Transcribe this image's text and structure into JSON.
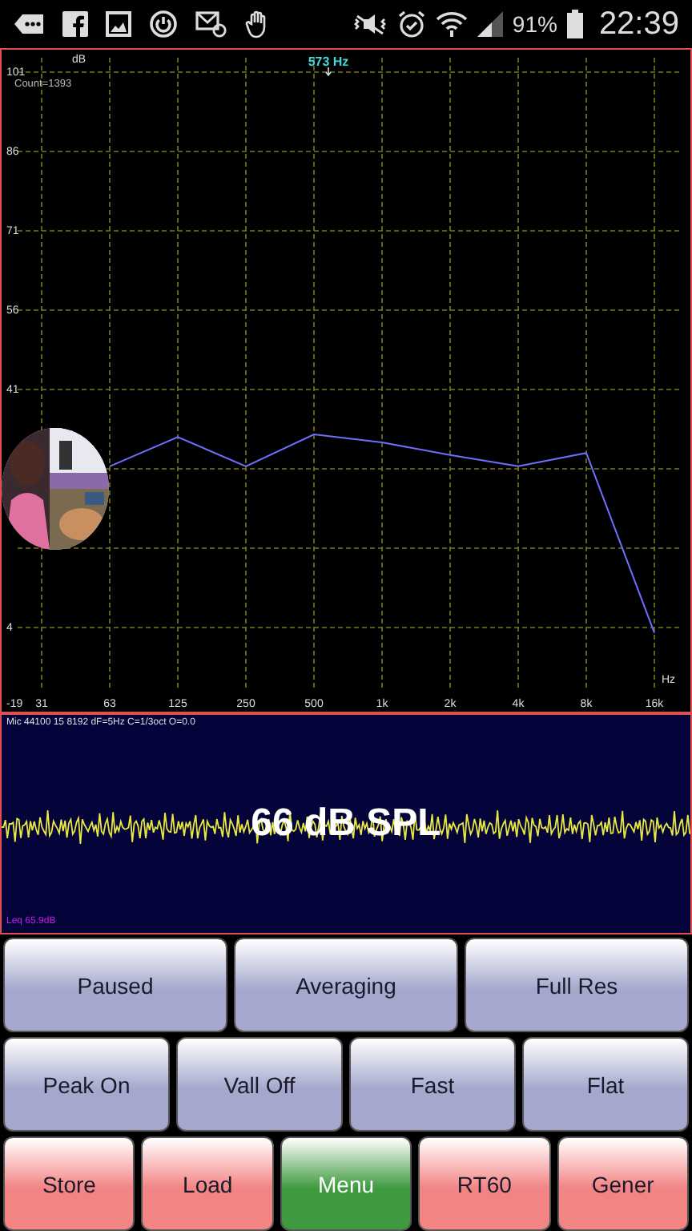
{
  "status_bar": {
    "battery": "91%",
    "time": "22:39"
  },
  "spectrum": {
    "count": "Count=1393",
    "peak_marker": "573 Hz",
    "chart_data": {
      "type": "line",
      "xlabel": "Hz",
      "ylabel": "dB",
      "categories": [
        "31",
        "63",
        "125",
        "250",
        "500",
        "1k",
        "2k",
        "4k",
        "8k",
        "16k"
      ],
      "series": [
        {
          "color": "#6f6fff",
          "values": [
            null,
            26.5,
            32,
            26.5,
            32.5,
            31,
            28.6,
            26.5,
            29,
            -5
          ]
        }
      ],
      "ylim": [
        -19,
        101
      ],
      "grid": true,
      "yticks": [
        101,
        86,
        71,
        56,
        41,
        {
          "value": -4,
          "label": "4"
        },
        -19
      ]
    }
  },
  "level_panel": {
    "info": "Mic 44100 15 8192 dF=5Hz C=1/3oct O=0.0",
    "spl": "66 dB SPL",
    "leq": "Leq 65.9dB"
  },
  "button_rows": [
    [
      {
        "label": "Paused",
        "color": "#a4a8cc"
      },
      {
        "label": "Averaging",
        "color": "#a4a8cc"
      },
      {
        "label": "Full Res",
        "color": "#a4a8cc"
      }
    ],
    [
      {
        "label": "Peak On",
        "color": "#a4a8cc"
      },
      {
        "label": "Vall Off",
        "color": "#a4a8cc"
      },
      {
        "label": "Fast",
        "color": "#a4a8cc"
      },
      {
        "label": "Flat",
        "color": "#a4a8cc"
      }
    ],
    [
      {
        "label": "Store",
        "color": "#f38484"
      },
      {
        "label": "Load",
        "color": "#f38484"
      },
      {
        "label": "Menu",
        "color": "#3f9a3f"
      },
      {
        "label": "RT60",
        "color": "#f38484"
      },
      {
        "label": "Gener",
        "color": "#f38484"
      }
    ]
  ]
}
